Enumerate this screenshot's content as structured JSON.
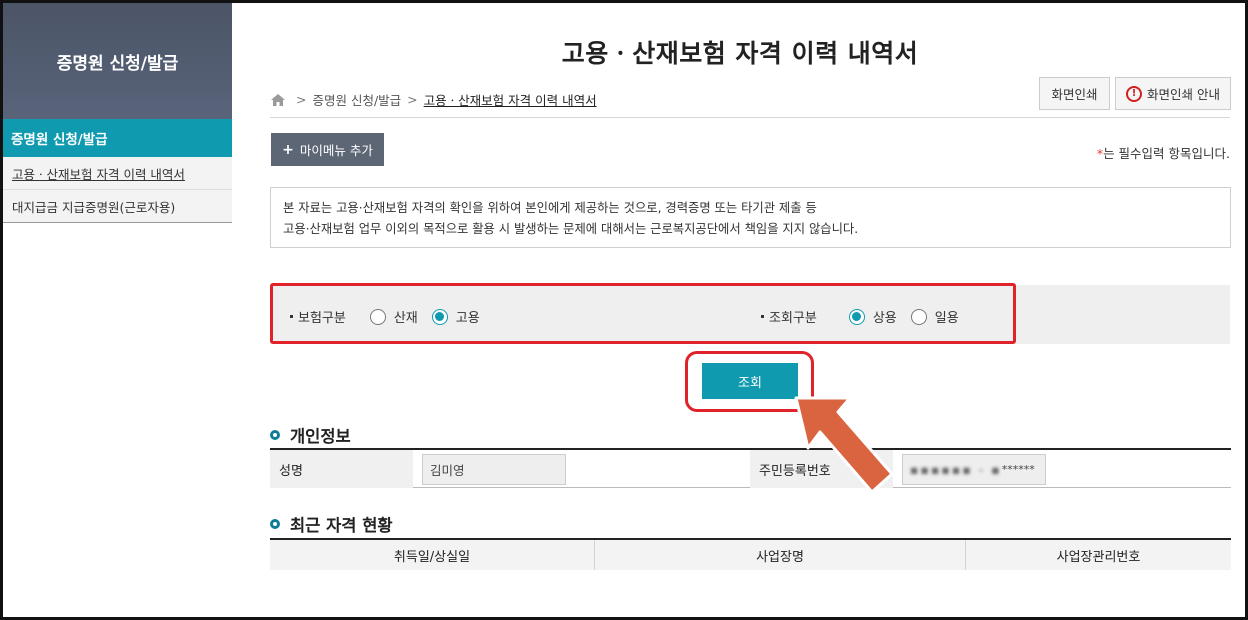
{
  "sidebar": {
    "title": "증명원 신청/발급",
    "active_section": "증명원 신청/발급",
    "items": [
      {
        "label": "고용ㆍ산재보험 자격 이력 내역서",
        "current": true
      },
      {
        "label": "대지급금 지급증명원(근로자용)",
        "current": false
      }
    ]
  },
  "page": {
    "title": "고용ㆍ산재보험 자격 이력 내역서"
  },
  "breadcrumb": {
    "items": [
      "증명원 신청/발급",
      "고용ㆍ산재보험 자격 이력 내역서"
    ],
    "home_icon": "home-icon"
  },
  "toolbar": {
    "print_label": "화면인쇄",
    "print_guide_label": "화면인쇄 안내",
    "print_guide_icon": "alert-circle-icon",
    "add_mymenu_label": "마이메뉴 추가"
  },
  "required_note": {
    "star": "*",
    "text": "는 필수입력 항목입니다."
  },
  "notice": {
    "lines": [
      "본 자료는 고용·산재보험 자격의 확인을 위하여 본인에게 제공하는 것으로, 경력증명 또는 타기관 제출 등",
      "고용·산재보험 업무 이외의 목적으로 활용 시 발생하는 문제에 대해서는 근로복지공단에서 책임을 지지 않습니다."
    ]
  },
  "search": {
    "insurance_type": {
      "label": "보험구분",
      "options": [
        "산재",
        "고용"
      ],
      "selected": "고용"
    },
    "query_type": {
      "label": "조회구분",
      "options": [
        "상용",
        "일용"
      ],
      "selected": "상용"
    },
    "button_label": "조회"
  },
  "personal": {
    "section_title": "개인정보",
    "name_label": "성명",
    "name_value": "김미영",
    "rrn_label": "주민등록번호",
    "rrn_value": "******"
  },
  "history": {
    "section_title": "최근 자격 현황",
    "columns": [
      "취득일/상실일",
      "사업장명",
      "사업장관리번호"
    ]
  },
  "colors": {
    "accent": "#0f9ab0",
    "sidebar_header": "#505a6e",
    "highlight": "#e0222a",
    "arrow": "#d9643f"
  }
}
